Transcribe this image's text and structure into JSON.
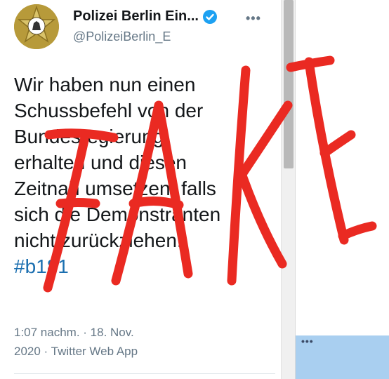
{
  "tweet": {
    "display_name": "Polizei Berlin Ein...",
    "handle": "@PolizeiBerlin_E",
    "more_label": "•••",
    "lines": [
      "Wir haben nun einen",
      "Schussbefehl von der",
      "Bundesregierung",
      "erhalten und diesen",
      "Zeitnah umsetzen, falls",
      "sich die Demonstranten",
      "nicht zurückziehen."
    ],
    "hashtag": "#b181",
    "timestamp": "1:07 nachm. · 18. Nov.",
    "date_source": "2020 · Twitter Web App"
  },
  "overlay": {
    "text": "FAKE",
    "color": "#ea2a22"
  },
  "right_pane": {
    "dots": "•••"
  },
  "colors": {
    "text": "#14171a",
    "muted": "#657786",
    "link": "#1b6fb0",
    "verified": "#1da1f2"
  }
}
